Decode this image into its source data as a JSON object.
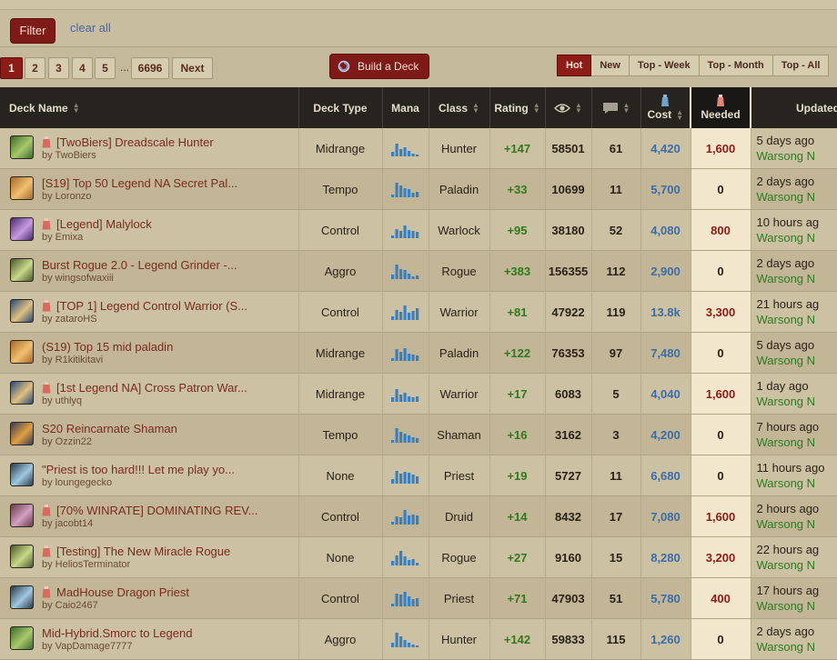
{
  "filter": {
    "button_label": "Filter",
    "clear_all_label": "clear all"
  },
  "pagination": {
    "pages": [
      "1",
      "2",
      "3",
      "4",
      "5"
    ],
    "ellipsis": "...",
    "last_page": "6696",
    "next_label": "Next"
  },
  "build_deck_label": "Build a Deck",
  "sort_tabs": [
    "Hot",
    "New",
    "Top - Week",
    "Top - Month",
    "Top - All"
  ],
  "columns": {
    "deck_name": "Deck Name",
    "deck_type": "Deck Type",
    "mana": "Mana",
    "class": "Class",
    "rating": "Rating",
    "cost": "Cost",
    "needed": "Needed",
    "updated": "Updated"
  },
  "colors": {
    "accent_red": "#8d1b16",
    "positive_green": "#2f7a1e",
    "cost_blue": "#3c6ca6"
  },
  "rows": [
    {
      "name": "[TwoBiers] Dreadscale Hunter",
      "author": "by TwoBiers",
      "type": "Midrange",
      "class": "Hunter",
      "rating": "+147",
      "views": "58501",
      "comments": "61",
      "cost": "4,420",
      "needed": "1,600",
      "updated": "5 days ago",
      "updater": "Warsong N",
      "potion": true,
      "icon": "hunter-icon",
      "mana": [
        0.3,
        0.9,
        0.5,
        0.6,
        0.35,
        0.2,
        0.15
      ]
    },
    {
      "name": "[S19] Top 50 Legend NA Secret Pal...",
      "author": "by Loronzo",
      "type": "Tempo",
      "class": "Paladin",
      "rating": "+33",
      "views": "10699",
      "comments": "11",
      "cost": "5,700",
      "needed": "0",
      "updated": "2 days ago",
      "updater": "Warsong N",
      "potion": false,
      "icon": "paladin-icon",
      "mana": [
        0.2,
        1,
        0.8,
        0.6,
        0.55,
        0.3,
        0.4
      ]
    },
    {
      "name": "[Legend] Malylock",
      "author": "by Emixa",
      "type": "Control",
      "class": "Warlock",
      "rating": "+95",
      "views": "38180",
      "comments": "52",
      "cost": "4,080",
      "needed": "800",
      "updated": "10 hours ag",
      "updater": "Warsong N",
      "potion": true,
      "icon": "warlock-icon",
      "mana": [
        0.2,
        0.6,
        0.5,
        0.9,
        0.55,
        0.5,
        0.45
      ]
    },
    {
      "name": "Burst Rogue 2.0 - Legend Grinder -...",
      "author": "by wingsofwaxiii",
      "type": "Aggro",
      "class": "Rogue",
      "rating": "+383",
      "views": "156355",
      "comments": "112",
      "cost": "2,900",
      "needed": "0",
      "updated": "2 days ago",
      "updater": "Warsong N",
      "potion": false,
      "icon": "rogue-icon",
      "mana": [
        0.3,
        1,
        0.7,
        0.6,
        0.4,
        0.2,
        0.25
      ]
    },
    {
      "name": "[TOP 1] Legend Control Warrior (S...",
      "author": "by zataroHS",
      "type": "Control",
      "class": "Warrior",
      "rating": "+81",
      "views": "47922",
      "comments": "119",
      "cost": "13.8k",
      "needed": "3,300",
      "updated": "21 hours ag",
      "updater": "Warsong N",
      "potion": true,
      "icon": "warrior-icon",
      "mana": [
        0.25,
        0.7,
        0.55,
        1,
        0.5,
        0.6,
        0.8
      ]
    },
    {
      "name": "(S19) Top 15 mid paladin",
      "author": "by R1kitikitavi",
      "type": "Midrange",
      "class": "Paladin",
      "rating": "+122",
      "views": "76353",
      "comments": "97",
      "cost": "7,480",
      "needed": "0",
      "updated": "5 days ago",
      "updater": "Warsong N",
      "potion": false,
      "icon": "paladin-icon",
      "mana": [
        0.2,
        0.8,
        0.6,
        0.9,
        0.5,
        0.45,
        0.4
      ]
    },
    {
      "name": "[1st Legend NA] Cross Patron War...",
      "author": "by uthlyq",
      "type": "Midrange",
      "class": "Warrior",
      "rating": "+17",
      "views": "6083",
      "comments": "5",
      "cost": "4,040",
      "needed": "1,600",
      "updated": "1 day ago",
      "updater": "Warsong N",
      "potion": true,
      "icon": "warrior-icon",
      "mana": [
        0.3,
        0.9,
        0.5,
        0.6,
        0.4,
        0.3,
        0.35
      ]
    },
    {
      "name": "S20 Reincarnate Shaman",
      "author": "by Ozzin22",
      "type": "Tempo",
      "class": "Shaman",
      "rating": "+16",
      "views": "3162",
      "comments": "3",
      "cost": "4,200",
      "needed": "0",
      "updated": "7 hours ago",
      "updater": "Warsong N",
      "potion": false,
      "icon": "shaman-icon",
      "mana": [
        0.2,
        1,
        0.75,
        0.6,
        0.5,
        0.35,
        0.3
      ]
    },
    {
      "name": "\"Priest is too hard!!! Let me play yo...",
      "author": "by loungegecko",
      "type": "None",
      "class": "Priest",
      "rating": "+19",
      "views": "5727",
      "comments": "11",
      "cost": "6,680",
      "needed": "0",
      "updated": "11 hours ago",
      "updater": "Warsong N",
      "potion": false,
      "icon": "priest-icon",
      "mana": [
        0.3,
        0.9,
        0.7,
        0.8,
        0.75,
        0.6,
        0.5
      ]
    },
    {
      "name": "[70% WINRATE] DOMINATING REV...",
      "author": "by jacobt14",
      "type": "Control",
      "class": "Druid",
      "rating": "+14",
      "views": "8432",
      "comments": "17",
      "cost": "7,080",
      "needed": "1,600",
      "updated": "2 hours ago",
      "updater": "Warsong N",
      "potion": true,
      "icon": "druid-icon",
      "mana": [
        0.2,
        0.55,
        0.5,
        1,
        0.6,
        0.7,
        0.65
      ]
    },
    {
      "name": "[Testing] The New Miracle Rogue",
      "author": "by HeliosTerminator",
      "type": "None",
      "class": "Rogue",
      "rating": "+27",
      "views": "9160",
      "comments": "15",
      "cost": "8,280",
      "needed": "3,200",
      "updated": "22 hours ag",
      "updater": "Warsong N",
      "potion": true,
      "icon": "rogue-icon",
      "mana": [
        0.3,
        0.7,
        1,
        0.6,
        0.35,
        0.45,
        0.2
      ]
    },
    {
      "name": "MadHouse Dragon Priest",
      "author": "by Caio2467",
      "type": "Control",
      "class": "Priest",
      "rating": "+71",
      "views": "47903",
      "comments": "51",
      "cost": "5,780",
      "needed": "400",
      "updated": "17 hours ag",
      "updater": "Warsong N",
      "potion": true,
      "icon": "priest-icon",
      "mana": [
        0.2,
        0.9,
        0.8,
        1,
        0.7,
        0.5,
        0.55
      ]
    },
    {
      "name": "Mid-Hybrid.Smorc to Legend",
      "author": "by VapDamage7777",
      "type": "Aggro",
      "class": "Hunter",
      "rating": "+142",
      "views": "59833",
      "comments": "115",
      "cost": "1,260",
      "needed": "0",
      "updated": "2 days ago",
      "updater": "Warsong N",
      "potion": false,
      "icon": "hunter-icon",
      "mana": [
        0.3,
        1,
        0.75,
        0.5,
        0.3,
        0.2,
        0.15
      ]
    }
  ]
}
